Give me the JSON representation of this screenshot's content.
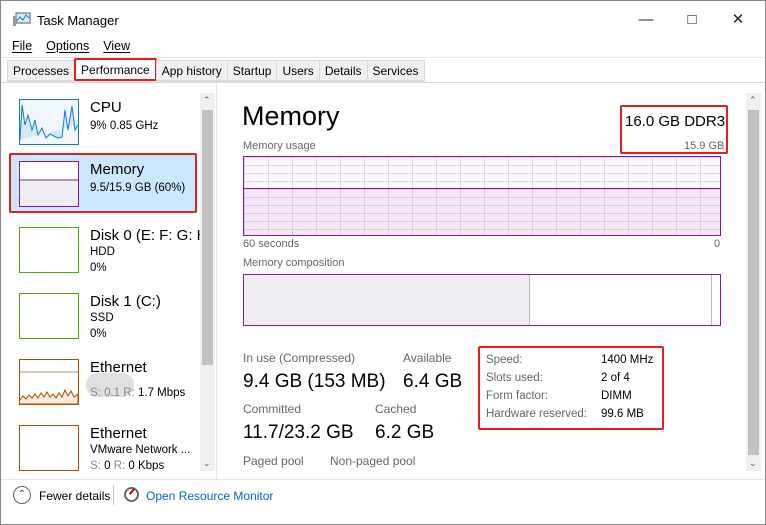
{
  "window": {
    "title": "Task Manager"
  },
  "menu": [
    "File",
    "Options",
    "View"
  ],
  "tabs": [
    "Processes",
    "Performance",
    "App history",
    "Startup",
    "Users",
    "Details",
    "Services"
  ],
  "sidebar": [
    {
      "name": "CPU",
      "line2": "9% 0.85 GHz",
      "color": "#117dbb"
    },
    {
      "name": "Memory",
      "line2": "9.5/15.9 GB (60%)",
      "color": "#8b12ae"
    },
    {
      "name": "Disk 0 (E: F: G: H",
      "line2": "HDD",
      "line3": "0%",
      "color": "#4da60c"
    },
    {
      "name": "Disk 1 (C:)",
      "line2": "SSD",
      "line3": "0%",
      "color": "#4da60c"
    },
    {
      "name": "Ethernet",
      "s": "S:",
      "sv": "0.1",
      "r": "R:",
      "rv": "1.7 Mbps",
      "color": "#a74f01"
    },
    {
      "name": "Ethernet",
      "line2": "VMware Network ...",
      "s": "S:",
      "sv": "0",
      "r": "R:",
      "rv": "0 Kbps",
      "color": "#a74f01"
    }
  ],
  "main": {
    "title": "Memory",
    "spec": "16.0 GB DDR3",
    "usage_label": "Memory usage",
    "usage_max": "15.9 GB",
    "time_left": "60 seconds",
    "time_right": "0",
    "composition_label": "Memory composition",
    "in_use_fraction": 0.6,
    "stats": {
      "inuse_label": "In use (Compressed)",
      "inuse": "9.4 GB (153 MB)",
      "avail_label": "Available",
      "avail": "6.4 GB",
      "committed_label": "Committed",
      "committed": "11.7/23.2 GB",
      "cached_label": "Cached",
      "cached": "6.2 GB",
      "paged_label": "Paged pool",
      "nonpaged_label": "Non-paged pool"
    },
    "details": [
      [
        "Speed:",
        "1400 MHz"
      ],
      [
        "Slots used:",
        "2 of 4"
      ],
      [
        "Form factor:",
        "DIMM"
      ],
      [
        "Hardware reserved:",
        "99.6 MB"
      ]
    ]
  },
  "footer": {
    "fewer": "Fewer details",
    "monitor": "Open Resource Monitor"
  }
}
